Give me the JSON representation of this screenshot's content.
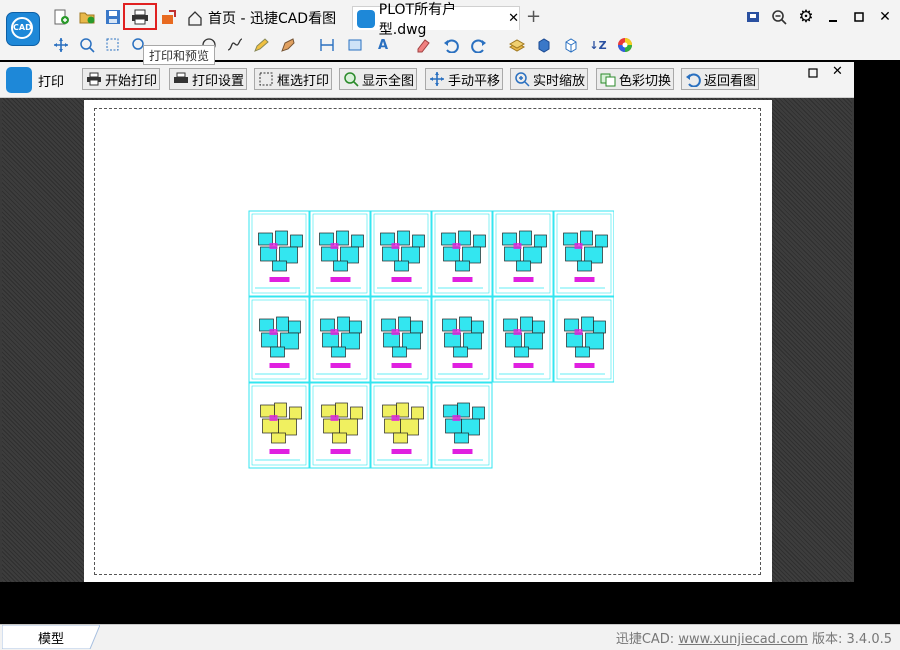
{
  "app": {
    "logo_text": "CAD"
  },
  "tabs": {
    "home_label": "首页 - 迅捷CAD看图",
    "file_label": "PLOT所有户型.dwg",
    "add_label": "+"
  },
  "tooltip": {
    "print_preview": "打印和预览"
  },
  "print_panel": {
    "title": "打印",
    "buttons": [
      {
        "label": "开始打印"
      },
      {
        "label": "打印设置"
      },
      {
        "label": "框选打印"
      },
      {
        "label": "显示全图"
      },
      {
        "label": "手动平移"
      },
      {
        "label": "实时缩放"
      },
      {
        "label": "色彩切换"
      },
      {
        "label": "返回看图"
      }
    ]
  },
  "status": {
    "model_tab": "模型",
    "brand": "迅捷CAD:",
    "url": "www.xunjiecad.com",
    "version_label": "版本:",
    "version": "3.4.0.5"
  },
  "colors": {
    "accent": "#1e88d8",
    "highlight": "#e02020",
    "drawing_cyan": "#33e6f0",
    "drawing_magenta": "#e020e0",
    "drawing_yellow": "#f0f060"
  },
  "icons": [
    "new-file-icon",
    "open-folder-icon",
    "save-icon",
    "print-icon",
    "export-icon",
    "home-icon",
    "pin-icon",
    "zoom-out-icon",
    "gear-icon",
    "minimize-icon",
    "maximize-icon",
    "close-icon"
  ]
}
